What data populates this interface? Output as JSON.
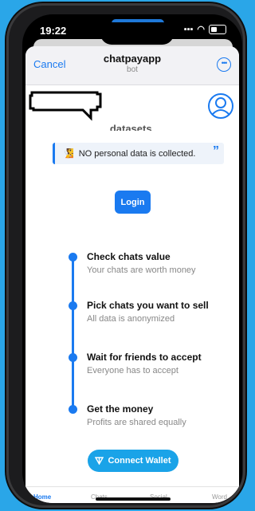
{
  "status": {
    "time": "19:22"
  },
  "nav": {
    "cancel": "Cancel",
    "title": "chatpayapp",
    "subtitle": "bot"
  },
  "intro": {
    "partial_text": "datasets."
  },
  "note": {
    "emoji": "🧏",
    "text": "NO personal data is collected."
  },
  "login_label": "Login",
  "steps": [
    {
      "title": "Check chats value",
      "desc": "Your chats are worth money"
    },
    {
      "title": "Pick chats you want to sell",
      "desc": "All data is anonymized"
    },
    {
      "title": "Wait for friends to accept",
      "desc": "Everyone has to accept"
    },
    {
      "title": "Get the money",
      "desc": "Profits are shared equally"
    }
  ],
  "wallet_label": "Connect Wallet",
  "tabs": [
    "Home",
    "Chats",
    "Social",
    "Word"
  ],
  "colors": {
    "accent": "#1a7af0",
    "background": "#2aa6e8",
    "wallet": "#1aa3e8"
  }
}
